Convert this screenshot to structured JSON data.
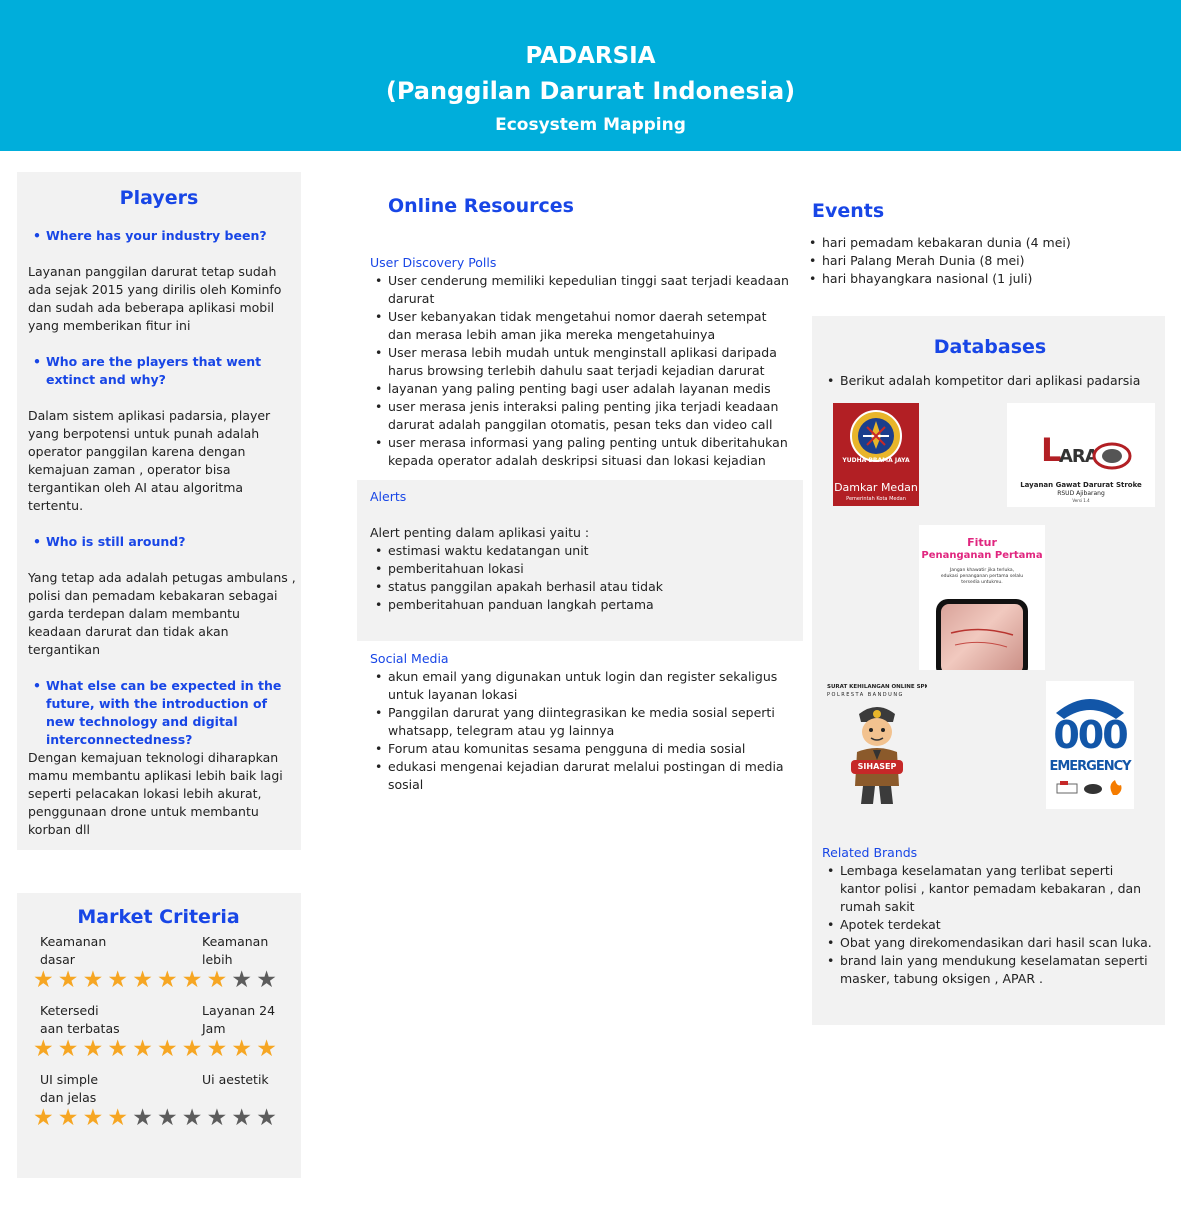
{
  "header": {
    "title": "PADARSIA",
    "subtitle": "(Panggilan Darurat Indonesia)",
    "caption": "Ecosystem Mapping"
  },
  "players": {
    "title": "Players",
    "q1": "Where has your industry been?",
    "a1": "Layanan panggilan darurat tetap sudah ada sejak 2015 yang dirilis oleh Kominfo dan sudah ada beberapa aplikasi mobil yang memberikan fitur ini",
    "q2": "Who are the players that went extinct and why?",
    "a2": "Dalam sistem aplikasi padarsia, player yang berpotensi  untuk punah adalah operator panggilan karena dengan kemajuan zaman , operator bisa tergantikan oleh AI atau algoritma tertentu.",
    "q3": "Who is still around?",
    "a3": "Yang tetap ada adalah petugas ambulans , polisi dan pemadam kebakaran sebagai garda terdepan dalam membantu keadaan darurat dan tidak akan tergantikan",
    "q4": "What else can be expected in the future, with the introduction of new technology and digital interconnectedness?",
    "a4": "Dengan kemajuan teknologi diharapkan mamu membantu aplikasi lebih baik lagi seperti pelacakan lokasi lebih akurat, penggunaan drone untuk membantu korban dll"
  },
  "market": {
    "title": "Market Criteria",
    "criteria": [
      {
        "label": "Keamanan dasar",
        "rating": 8,
        "max": 10
      },
      {
        "label": "Keamanan lebih",
        "rating": 8,
        "max": 10
      },
      {
        "label": "Ketersediaan terbatas",
        "rating": 10,
        "max": 10
      },
      {
        "label": "Layanan 24 Jam",
        "rating": 10,
        "max": 10
      },
      {
        "label": "UI simple dan jelas",
        "rating": 4,
        "max": 10
      },
      {
        "label": "Ui aestetik",
        "rating": 4,
        "max": 10
      }
    ],
    "labels": {
      "c1": [
        "Keamanan",
        "dasar"
      ],
      "c2": [
        "Keamanan",
        "lebih"
      ],
      "c3": [
        "Ketersedi",
        "aan terbatas"
      ],
      "c4": [
        "Layanan 24",
        "Jam"
      ],
      "c5": [
        "UI simple",
        "dan jelas"
      ],
      "c6": [
        "Ui aestetik"
      ]
    }
  },
  "online": {
    "title": "Online Resources",
    "polls_label": "User Discovery Polls",
    "polls": [
      "User cenderung memiliki kepedulian tinggi saat terjadi keadaan darurat",
      "User kebanyakan tidak mengetahui nomor daerah setempat dan merasa lebih aman jika mereka mengetahuinya",
      "User merasa lebih mudah untuk menginstall aplikasi daripada harus browsing terlebih dahulu saat terjadi kejadian darurat",
      "layanan yang paling penting bagi user adalah layanan medis",
      "user merasa jenis interaksi paling penting jika terjadi keadaan darurat adalah panggilan otomatis, pesan teks dan video call",
      "user merasa informasi yang paling penting untuk diberitahukan kepada operator adalah deskripsi situasi dan lokasi kejadian"
    ],
    "alerts_label": "Alerts",
    "alerts_intro": "Alert penting dalam aplikasi yaitu :",
    "alerts": [
      "estimasi waktu kedatangan unit",
      "pemberitahuan lokasi",
      "status panggilan apakah berhasil atau tidak",
      "pemberitahuan panduan langkah pertama"
    ],
    "social_label": "Social Media",
    "social": [
      "akun email yang digunakan untuk login dan register sekaligus untuk layanan lokasi",
      "Panggilan darurat yang diintegrasikan ke media sosial seperti whatsapp, telegram atau yg lainnya",
      "Forum atau komunitas sesama pengguna di media sosial",
      "edukasi mengenai kejadian darurat melalui postingan di media sosial"
    ]
  },
  "events": {
    "title": "Events",
    "items": [
      "hari pemadam kebakaran dunia (4 mei)",
      "hari Palang Merah Dunia (8 mei)",
      "hari bhayangkara nasional (1 juli)"
    ]
  },
  "databases": {
    "title": "Databases",
    "intro": "Berikut adalah kompetitor dari aplikasi padarsia",
    "logos": {
      "damkar_name": "Damkar Medan",
      "damkar_sub": "Pemerintah Kota Medan",
      "damkar_ring": "YUDHA BRAMA JAYA",
      "laras_word": "ARAS",
      "laras_l": "L",
      "laras_name": "Layanan Gawat Darurat Stroke",
      "laras_sub": "RSUD Ajibarang",
      "laras_ver": "Versi 1.4",
      "fitur_title1": "Fitur",
      "fitur_title2": "Penanganan Pertama",
      "fitur_sub1": "Jangan khawatir jika terluka,",
      "fitur_sub2": "edukasi penanganan pertama selalu",
      "fitur_sub3": "tersedia untukmu.",
      "sihasep_title": "SURAT KEHILANGAN ONLINE SPKT",
      "sihasep_sub": "POLRESTA BANDUNG",
      "sihasep_badge": "SIHASEP",
      "emergency_num": "000",
      "emergency_word": "EMERGENCY"
    },
    "brands_label": "Related Brands",
    "brands": [
      "Lembaga keselamatan yang terlibat seperti kantor polisi , kantor pemadam kebakaran , dan rumah sakit",
      "Apotek terdekat",
      "Obat yang direkomendasikan dari hasil scan luka.",
      "brand lain yang mendukung keselamatan seperti masker, tabung oksigen , APAR ."
    ]
  },
  "colors": {
    "header": "#00AEDB",
    "title_blue": "#1846E6",
    "panel": "#F2F2F2",
    "star_on": "#F6A623",
    "star_off": "#5C5C5C",
    "damkar_red": "#B21F24",
    "emergency_blue": "#1256A8"
  }
}
